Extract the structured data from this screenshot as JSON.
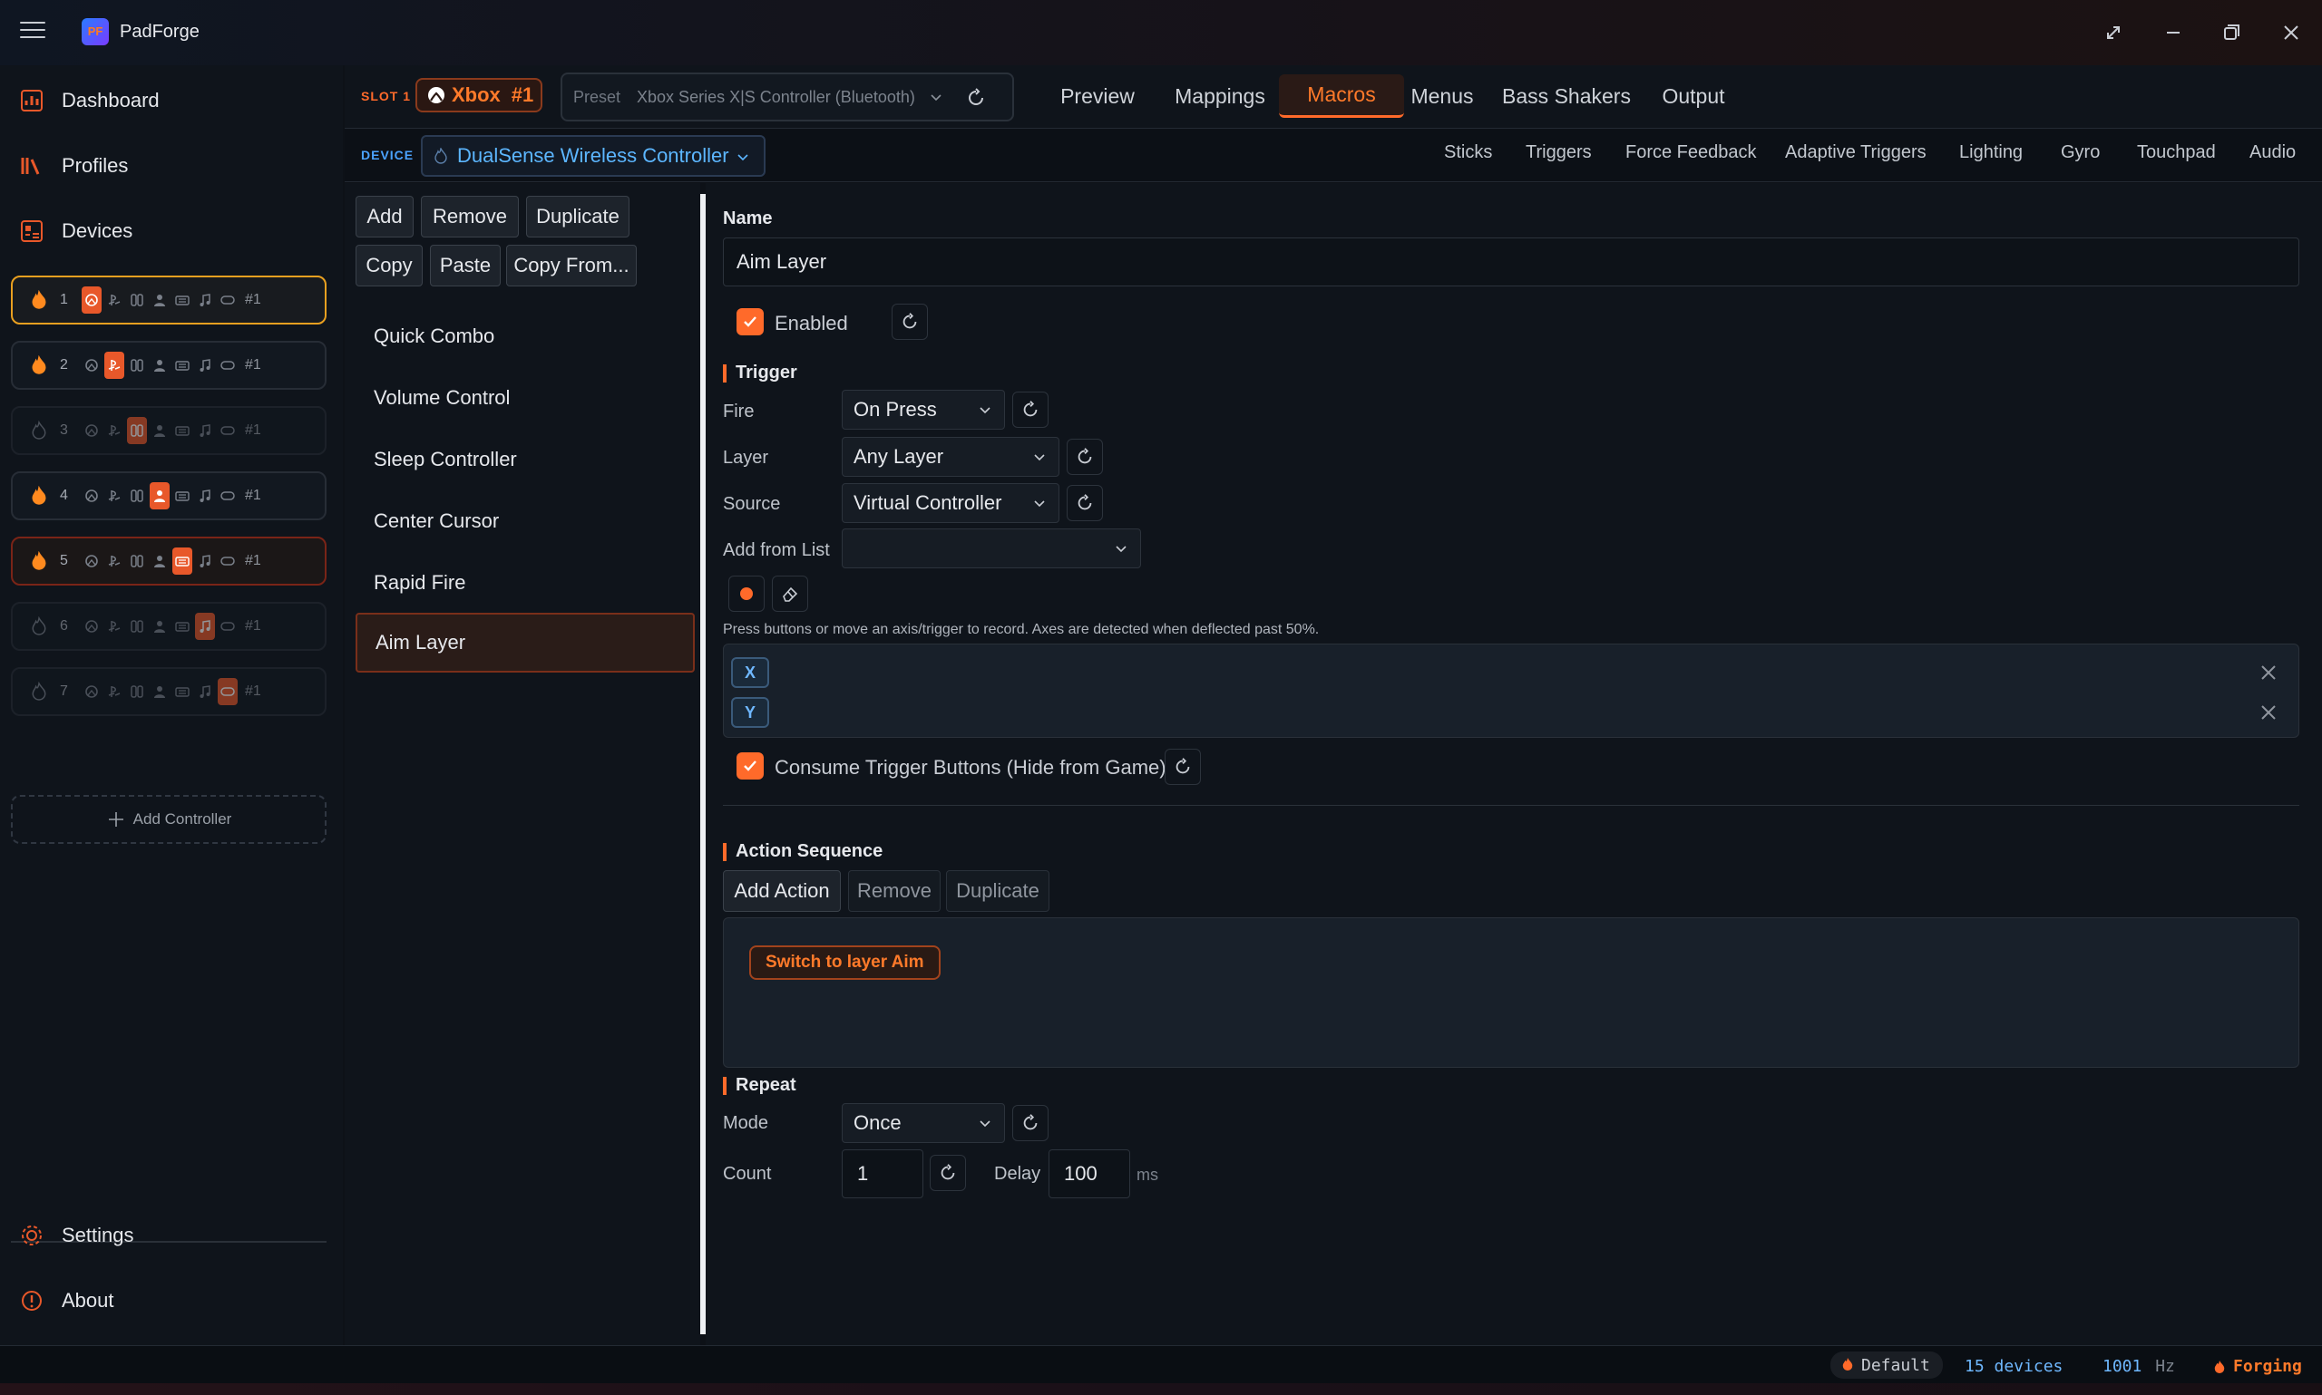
{
  "app": {
    "title": "PadForge",
    "logo_text": "PF"
  },
  "sidebar": {
    "nav": [
      {
        "label": "Dashboard",
        "icon": "dashboard-icon"
      },
      {
        "label": "Profiles",
        "icon": "profiles-icon"
      },
      {
        "label": "Devices",
        "icon": "devices-icon"
      }
    ],
    "slots": [
      {
        "num": "1",
        "active_icon": 0,
        "suffix": "#1"
      },
      {
        "num": "2",
        "active_icon": 1,
        "suffix": "#1"
      },
      {
        "num": "3",
        "active_icon": 2,
        "suffix": "#1"
      },
      {
        "num": "4",
        "active_icon": 3,
        "suffix": "#1"
      },
      {
        "num": "5",
        "active_icon": 4,
        "suffix": "#1"
      },
      {
        "num": "6",
        "active_icon": 5,
        "suffix": "#1"
      },
      {
        "num": "7",
        "active_icon": 6,
        "suffix": "#1"
      }
    ],
    "add_controller": "Add Controller",
    "settings": "Settings",
    "about": "About"
  },
  "topbar": {
    "slot_label": "SLOT 1",
    "badge": "Xbox",
    "badge_num": "#1",
    "preset_label": "Preset",
    "preset_value": "Xbox Series X|S Controller (Bluetooth)",
    "tabs": [
      "Preview",
      "Mappings",
      "Macros",
      "Menus",
      "Bass Shakers",
      "Output"
    ],
    "active_tab": "Macros"
  },
  "devicebar": {
    "label": "DEVICE",
    "device": "DualSense Wireless Controller",
    "subtabs": [
      "Sticks",
      "Triggers",
      "Force Feedback",
      "Adaptive Triggers",
      "Lighting",
      "Gyro",
      "Touchpad",
      "Audio"
    ]
  },
  "macros": {
    "buttons": {
      "add": "Add",
      "remove": "Remove",
      "duplicate": "Duplicate",
      "copy": "Copy",
      "paste": "Paste",
      "copy_from": "Copy From..."
    },
    "items": [
      "Quick Combo",
      "Volume Control",
      "Sleep Controller",
      "Center Cursor",
      "Rapid Fire",
      "Aim Layer"
    ],
    "selected": "Aim Layer"
  },
  "form": {
    "name_label": "Name",
    "name_value": "Aim Layer",
    "enabled_label": "Enabled",
    "trigger_header": "Trigger",
    "fire_label": "Fire",
    "fire_value": "On Press",
    "layer_label": "Layer",
    "layer_value": "Any Layer",
    "source_label": "Source",
    "source_value": "Virtual Controller",
    "add_from_list_label": "Add from List",
    "add_from_list_value": "",
    "record_hint": "Press buttons or move an axis/trigger to record. Axes are detected when deflected past 50%.",
    "recorded": [
      "X",
      "Y"
    ],
    "consume_label": "Consume Trigger Buttons (Hide from Game)",
    "action_header": "Action Sequence",
    "add_action": "Add Action",
    "remove_action": "Remove",
    "duplicate_action": "Duplicate",
    "actions": [
      "Switch to layer Aim"
    ],
    "repeat_header": "Repeat",
    "mode_label": "Mode",
    "mode_value": "Once",
    "count_label": "Count",
    "count_value": "1",
    "delay_label": "Delay",
    "delay_value": "100",
    "delay_unit": "ms"
  },
  "status": {
    "profile": "Default",
    "devices": "15 devices",
    "hz_value": "1001",
    "hz_unit": "Hz",
    "state": "Forging"
  },
  "colors": {
    "accent": "#ff6a2a",
    "device_blue": "#4ba3ff",
    "selected_slot_border": "#e9a020"
  }
}
